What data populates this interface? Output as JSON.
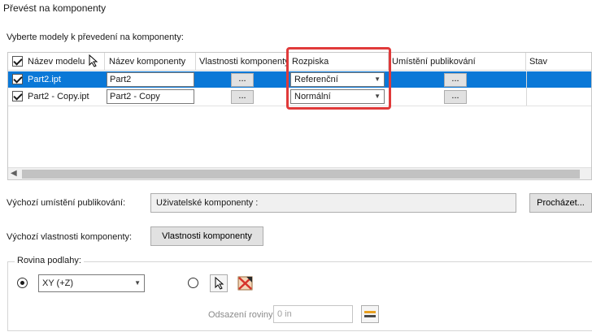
{
  "dialog": {
    "title": "Převést na komponenty",
    "subtitle": "Vyberte modely k převedení na komponenty:"
  },
  "grid": {
    "columns": [
      "Název modelu",
      "Název komponenty",
      "Vlastnosti komponenty",
      "Rozpiska",
      "Umístění publikování",
      "Stav"
    ],
    "rows": [
      {
        "checked": true,
        "model": "Part2.ipt",
        "component": "Part2",
        "props_btn": "...",
        "bom": "Referenční",
        "location_btn": "...",
        "status": "",
        "selected": true
      },
      {
        "checked": true,
        "model": "Part2 - Copy.ipt",
        "component": "Part2 - Copy",
        "props_btn": "...",
        "bom": "Normální",
        "location_btn": "...",
        "status": "",
        "selected": false
      }
    ]
  },
  "publish": {
    "label": "Výchozí umístění publikování:",
    "value": "Uživatelské komponenty :",
    "browse": "Procházet..."
  },
  "properties": {
    "label": "Výchozí vlastnosti komponenty:",
    "button": "Vlastnosti komponenty"
  },
  "floor_plane": {
    "group_label": "Rovina podlahy:",
    "plane_value": "XY (+Z)",
    "offset_label": "Odsazení roviny",
    "offset_value": "0 in"
  },
  "colors": {
    "selection": "#0a78d7",
    "highlight": "#e03a3a"
  },
  "icons": [
    "checkbox-icon",
    "cursor-icon",
    "pick-plane-icon",
    "flip-plane-icon",
    "measure-icon",
    "chevron-down-icon"
  ]
}
